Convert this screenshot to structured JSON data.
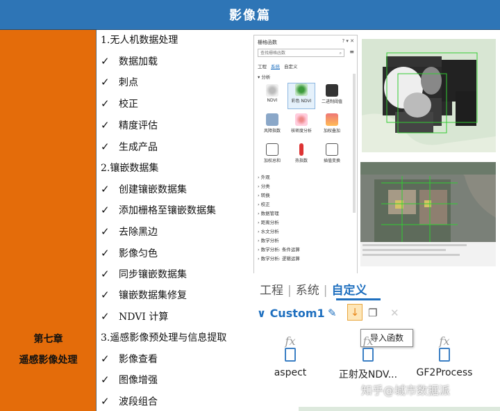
{
  "header": {
    "title": "影像篇"
  },
  "chapter": {
    "number": "第七章",
    "name": "遥感影像处理"
  },
  "outline": {
    "s1": "1.无人机数据处理",
    "s1_items": [
      "数据加载",
      "刺点",
      "校正",
      "精度评估",
      "生成产品"
    ],
    "s2": "2.镶嵌数据集",
    "s2_items": [
      "创建镶嵌数据集",
      "添加栅格至镶嵌数据集",
      "去除黑边",
      "影像匀色",
      "同步镶嵌数据集",
      "镶嵌数据集修复",
      "NDVI 计算"
    ],
    "s3": "3.遥感影像预处理与信息提取",
    "s3_items": [
      "影像查看",
      "图像增强",
      "波段组合"
    ],
    "check": "✓"
  },
  "raster_panel": {
    "title": "栅格函数",
    "controls": "? ▾ ✕",
    "search_placeholder": "查找栅格函数",
    "tabs": [
      "工程",
      "系统",
      "自定义"
    ],
    "active_tab": "系统",
    "section": "▾ 分析",
    "functions": [
      "NDVI",
      "彩色 NDVI",
      "二进制阈值",
      "风障指数",
      "核密度分析",
      "加权叠加",
      "加权总和",
      "热指数",
      "插值变换"
    ],
    "categories": [
      "› 外观",
      "› 分类",
      "› 转换",
      "› 校正",
      "› 数据管理",
      "› 距离分析",
      "› 水文分析",
      "› 数学分析",
      "› 数学分析: 条件运算",
      "› 数学分析: 逻辑运算"
    ]
  },
  "custom_panel": {
    "tabs": [
      "工程",
      "系统",
      "自定义"
    ],
    "active_tab": "自定义",
    "group": "Custom1",
    "tooltip": "导入函数",
    "tools": [
      {
        "fx": "fx",
        "label": "aspect"
      },
      {
        "fx": "fx",
        "label": "正射及NDV..."
      },
      {
        "fx": "fx",
        "label": "GF2Process"
      }
    ]
  },
  "watermark": "知乎@城市数据派",
  "colors": {
    "header": "#2e75b6",
    "chapter": "#e46c0a",
    "accent": "#1e6fbf"
  }
}
